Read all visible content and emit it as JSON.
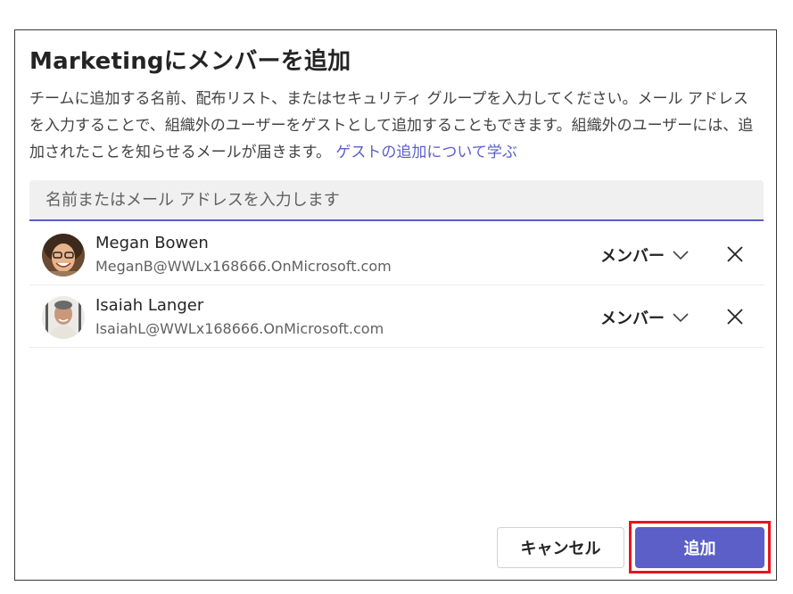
{
  "dialog": {
    "title": "Marketingにメンバーを追加",
    "description": "チームに追加する名前、配布リスト、またはセキュリティ グループを入力してください。メール アドレスを入力することで、組織外のユーザーをゲストとして追加することもできます。組織外のユーザーには、追加されたことを知らせるメールが届きます。",
    "learn_link": "ゲストの追加について学ぶ"
  },
  "search": {
    "placeholder": "名前またはメール アドレスを入力します",
    "value": ""
  },
  "members": [
    {
      "name": "Megan Bowen",
      "email": "MeganB@WWLx168666.OnMicrosoft.com",
      "role": "メンバー",
      "avatar_icon": "person-avatar-photo"
    },
    {
      "name": "Isaiah Langer",
      "email": "IsaiahL@WWLx168666.OnMicrosoft.com",
      "role": "メンバー",
      "avatar_icon": "person-avatar-photo"
    }
  ],
  "buttons": {
    "cancel_label": "キャンセル",
    "add_label": "追加"
  },
  "colors": {
    "accent": "#5b5fc7",
    "highlight": "#e8141c"
  }
}
